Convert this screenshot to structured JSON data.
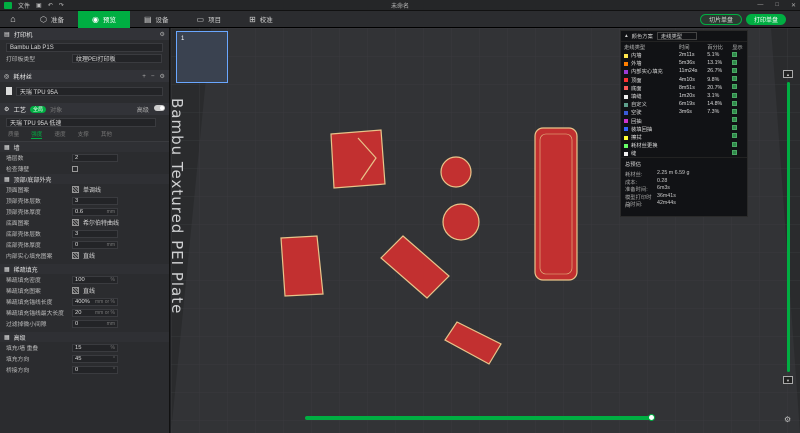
{
  "titlebar": {
    "file_menu": "文件",
    "title": "未命名"
  },
  "tabs": [
    {
      "label": "准备",
      "icon": "cube-icon"
    },
    {
      "label": "预览",
      "icon": "eye-icon"
    },
    {
      "label": "设备",
      "icon": "printer-icon"
    },
    {
      "label": "项目",
      "icon": "folder-icon"
    },
    {
      "label": "校准",
      "icon": "calibrate-icon"
    }
  ],
  "actions": {
    "slice": "切片单盘",
    "print": "打印单盘"
  },
  "printer": {
    "header": "打印机",
    "name": "Bambu Lab P1S",
    "plate_type_label": "打印板类型",
    "plate_type_value": "纹理PEI打印板"
  },
  "filament": {
    "header": "耗材丝",
    "item": "天瑞 TPU 95A"
  },
  "process": {
    "header": "工艺",
    "global_badge": "全局",
    "object_label": "对象",
    "advanced_label": "高级",
    "preset": "天瑞 TPU 95A 低速",
    "subtabs": [
      "质量",
      "强度",
      "速度",
      "支撑",
      "其他"
    ],
    "active_subtab": 1
  },
  "walls": {
    "header": "墙",
    "rows": [
      {
        "label": "墙层数",
        "value": "2",
        "unit": ""
      },
      {
        "label": "检查薄壁",
        "value": "",
        "unit": ""
      }
    ]
  },
  "top_bottom": {
    "header": "顶部/底部外壳",
    "rows": [
      {
        "label": "顶面图案",
        "value": "单调线",
        "unit": ""
      },
      {
        "label": "顶部壳体层数",
        "value": "3",
        "unit": ""
      },
      {
        "label": "顶部壳体厚度",
        "value": "0.6",
        "unit": "mm"
      },
      {
        "label": "底面图案",
        "value": "希尔伯特曲线",
        "unit": ""
      },
      {
        "label": "底部壳体层数",
        "value": "3",
        "unit": ""
      },
      {
        "label": "底部壳体厚度",
        "value": "0",
        "unit": "mm"
      },
      {
        "label": "内部实心填充图案",
        "value": "直线",
        "unit": ""
      }
    ]
  },
  "infill": {
    "header": "稀疏填充",
    "rows": [
      {
        "label": "稀疏填充密度",
        "value": "100",
        "unit": "%"
      },
      {
        "label": "稀疏填充图案",
        "value": "直线",
        "unit": ""
      },
      {
        "label": "稀疏填充锚线长度",
        "value": "400%",
        "unit": "mm or %"
      },
      {
        "label": "稀疏填充锚线最大长度",
        "value": "20",
        "unit": "mm or %"
      },
      {
        "label": "过滤掉微小间隙",
        "value": "0",
        "unit": "mm"
      }
    ]
  },
  "advanced": {
    "header": "高级",
    "rows": [
      {
        "label": "填充/墙 重叠",
        "value": "15",
        "unit": "%"
      },
      {
        "label": "填充方向",
        "value": "45",
        "unit": "°"
      },
      {
        "label": "桥接方向",
        "value": "0",
        "unit": "°"
      }
    ]
  },
  "thumbnail": {
    "number": "1"
  },
  "plate_text": "Bambu Textured PEI Plate",
  "legend": {
    "scheme_label": "颜色方案",
    "scheme_value": "走线类型",
    "columns": [
      "走线类型",
      "时间",
      "百分比",
      "显示"
    ],
    "rows": [
      {
        "name": "内墙",
        "time": "2m11s",
        "pct": "5.1%",
        "color": "#ffe64d"
      },
      {
        "name": "外墙",
        "time": "5m36s",
        "pct": "13.1%",
        "color": "#ff7f00"
      },
      {
        "name": "内部实心填充",
        "time": "11m24s",
        "pct": "26.7%",
        "color": "#9b3bd6"
      },
      {
        "name": "顶面",
        "time": "4m10s",
        "pct": "9.8%",
        "color": "#ff3333"
      },
      {
        "name": "底面",
        "time": "8m51s",
        "pct": "20.7%",
        "color": "#ff5a5a"
      },
      {
        "name": "填缝",
        "time": "1m20s",
        "pct": "3.1%",
        "color": "#eeeeee"
      },
      {
        "name": "自定义",
        "time": "6m19s",
        "pct": "14.8%",
        "color": "#5e9f8c"
      },
      {
        "name": "空驶",
        "time": "3m6s",
        "pct": "7.3%",
        "color": "#3a5bd6"
      },
      {
        "name": "回抽",
        "time": "",
        "pct": "",
        "color": "#cc33cc"
      },
      {
        "name": "装填回抽",
        "time": "",
        "pct": "",
        "color": "#3366ff"
      },
      {
        "name": "擦拭",
        "time": "",
        "pct": "",
        "color": "#ffff33"
      },
      {
        "name": "耗材丝更换",
        "time": "",
        "pct": "",
        "color": "#66ff66"
      },
      {
        "name": "缝",
        "time": "",
        "pct": "",
        "color": "#f0f0f0"
      }
    ],
    "summary": {
      "title": "总预估",
      "items": [
        {
          "k": "耗材丝:",
          "v": "2.25 m   6.59 g"
        },
        {
          "k": "成本:",
          "v": "0.28"
        },
        {
          "k": "准备时间:",
          "v": "6m3s"
        },
        {
          "k": "模型打印时间:",
          "v": "36m41s"
        },
        {
          "k": "总时间:",
          "v": "42m44s"
        }
      ]
    }
  },
  "colors": {
    "accent": "#00ae42",
    "part": "#c23030",
    "part_edge": "#e8c48a"
  }
}
